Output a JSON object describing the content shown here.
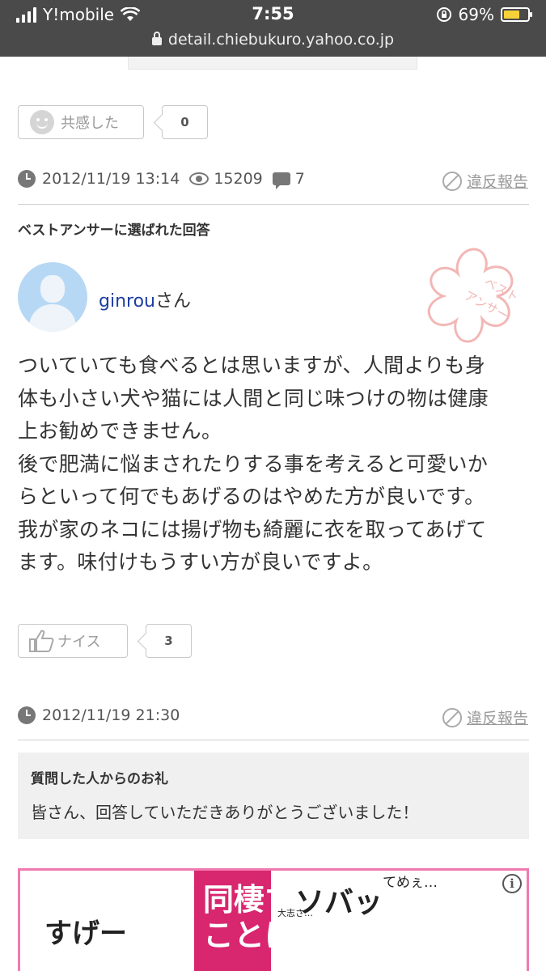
{
  "status_bar": {
    "carrier": "Y!mobile",
    "time": "7:55",
    "battery_percent": "69%",
    "battery_level": 0.69,
    "url": "detail.chiebukuro.yahoo.co.jp"
  },
  "question_footer": {
    "empathy_label": "共感した",
    "empathy_count": "0",
    "date": "2012/11/19 13:14",
    "views": "15209",
    "answers": "7",
    "report_label": "違反報告"
  },
  "best_answer": {
    "section_title": "ベストアンサーに選ばれた回答",
    "user_name": "ginrou",
    "user_suffix": "さん",
    "stamp_text": "ベスト\nアンサー",
    "body": "ついていても食べるとは思いますが、人間よりも身\n体も小さい犬や猫には人間と同じ味つけの物は健康\n上お勧めできません。\n後で肥満に悩まされたりする事を考えると可愛いか\nらといって何でもあげるのはやめた方が良いです。\n我が家のネコには揚げ物も綺麗に衣を取ってあげて\nます。味付けもうすい方が良いですよ。",
    "nice_label": "ナイス",
    "nice_count": "3",
    "date": "2012/11/19 21:30",
    "report_label": "違反報告"
  },
  "thanks": {
    "title": "質問した人からのお礼",
    "body": "皆さん、回答していただきありがとうございました！"
  },
  "ad": {
    "text_left": "すげー",
    "text_pink": "同棲す\nことに…",
    "text_mid": "ソバッ",
    "text_right": "てめぇ…",
    "text_small": "大志さ…",
    "info_icon": "i"
  },
  "colors": {
    "status_bg": "#4a4a4a",
    "link": "#1d3ea1",
    "ad_border": "#f07ab0",
    "ad_pink": "#d8266f"
  }
}
